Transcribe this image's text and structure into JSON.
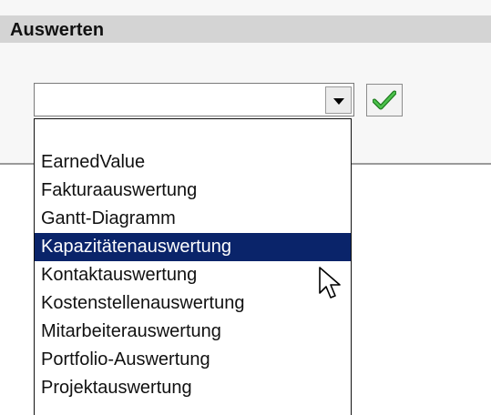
{
  "panel": {
    "title": "Auswerten"
  },
  "select": {
    "value": "",
    "arrow_icon": "chevron-down-icon"
  },
  "confirm_button": {
    "icon": "checkmark-icon",
    "icon_color": "#2ea32e"
  },
  "dropdown": {
    "items": [
      {
        "label": ""
      },
      {
        "label": "EarnedValue"
      },
      {
        "label": "Fakturaauswertung"
      },
      {
        "label": "Gantt-Diagramm"
      },
      {
        "label": "Kapazitätenauswertung"
      },
      {
        "label": "Kontaktauswertung"
      },
      {
        "label": "Kostenstellenauswertung"
      },
      {
        "label": "Mitarbeiterauswertung"
      },
      {
        "label": "Portfolio-Auswertung"
      },
      {
        "label": "Projektauswertung"
      }
    ],
    "selected_label": "Kapazitätenauswertung",
    "selected_color": "#0a246a"
  },
  "cursor": {
    "icon": "mouse-pointer-icon"
  }
}
